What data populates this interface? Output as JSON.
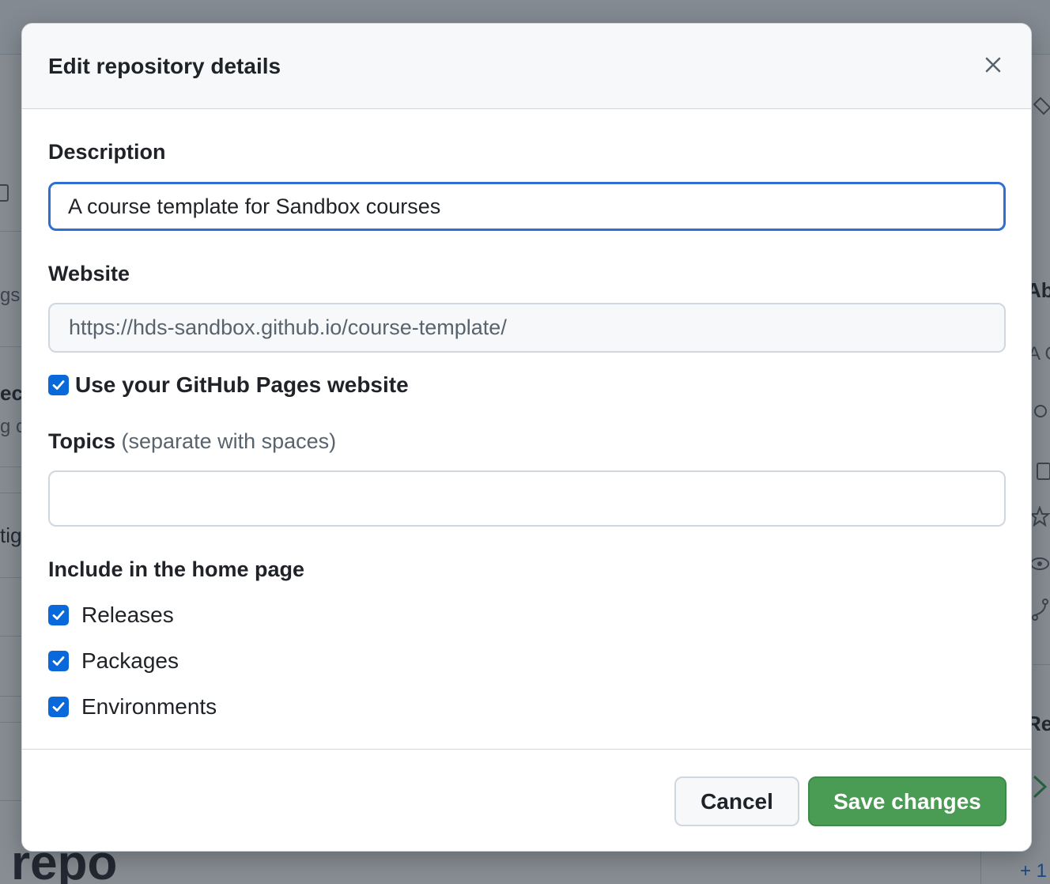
{
  "background": {
    "fragments": {
      "gs": "gs",
      "ect": "ect",
      "g_c": "g c",
      "tig": "tig",
      "ab": "Ab",
      "a_c": "A C",
      "re": "Re",
      "plus": "+ 1"
    },
    "repo_heading": "repo"
  },
  "dialog": {
    "title": "Edit repository details",
    "close_icon": "close-icon"
  },
  "form": {
    "description": {
      "label": "Description",
      "value": "A course template for Sandbox courses"
    },
    "website": {
      "label": "Website",
      "value": "https://hds-sandbox.github.io/course-template/"
    },
    "use_pages": {
      "label": "Use your GitHub Pages website",
      "checked": true
    },
    "topics": {
      "label": "Topics",
      "hint": "(separate with spaces)",
      "value": ""
    },
    "home_page": {
      "heading": "Include in the home page",
      "options": [
        {
          "label": "Releases",
          "checked": true
        },
        {
          "label": "Packages",
          "checked": true
        },
        {
          "label": "Environments",
          "checked": true
        }
      ]
    }
  },
  "footer": {
    "cancel_label": "Cancel",
    "save_label": "Save changes"
  },
  "colors": {
    "accent": "#0969da",
    "focus_border": "#2f6fd1",
    "save_button": "#4a9b53"
  }
}
